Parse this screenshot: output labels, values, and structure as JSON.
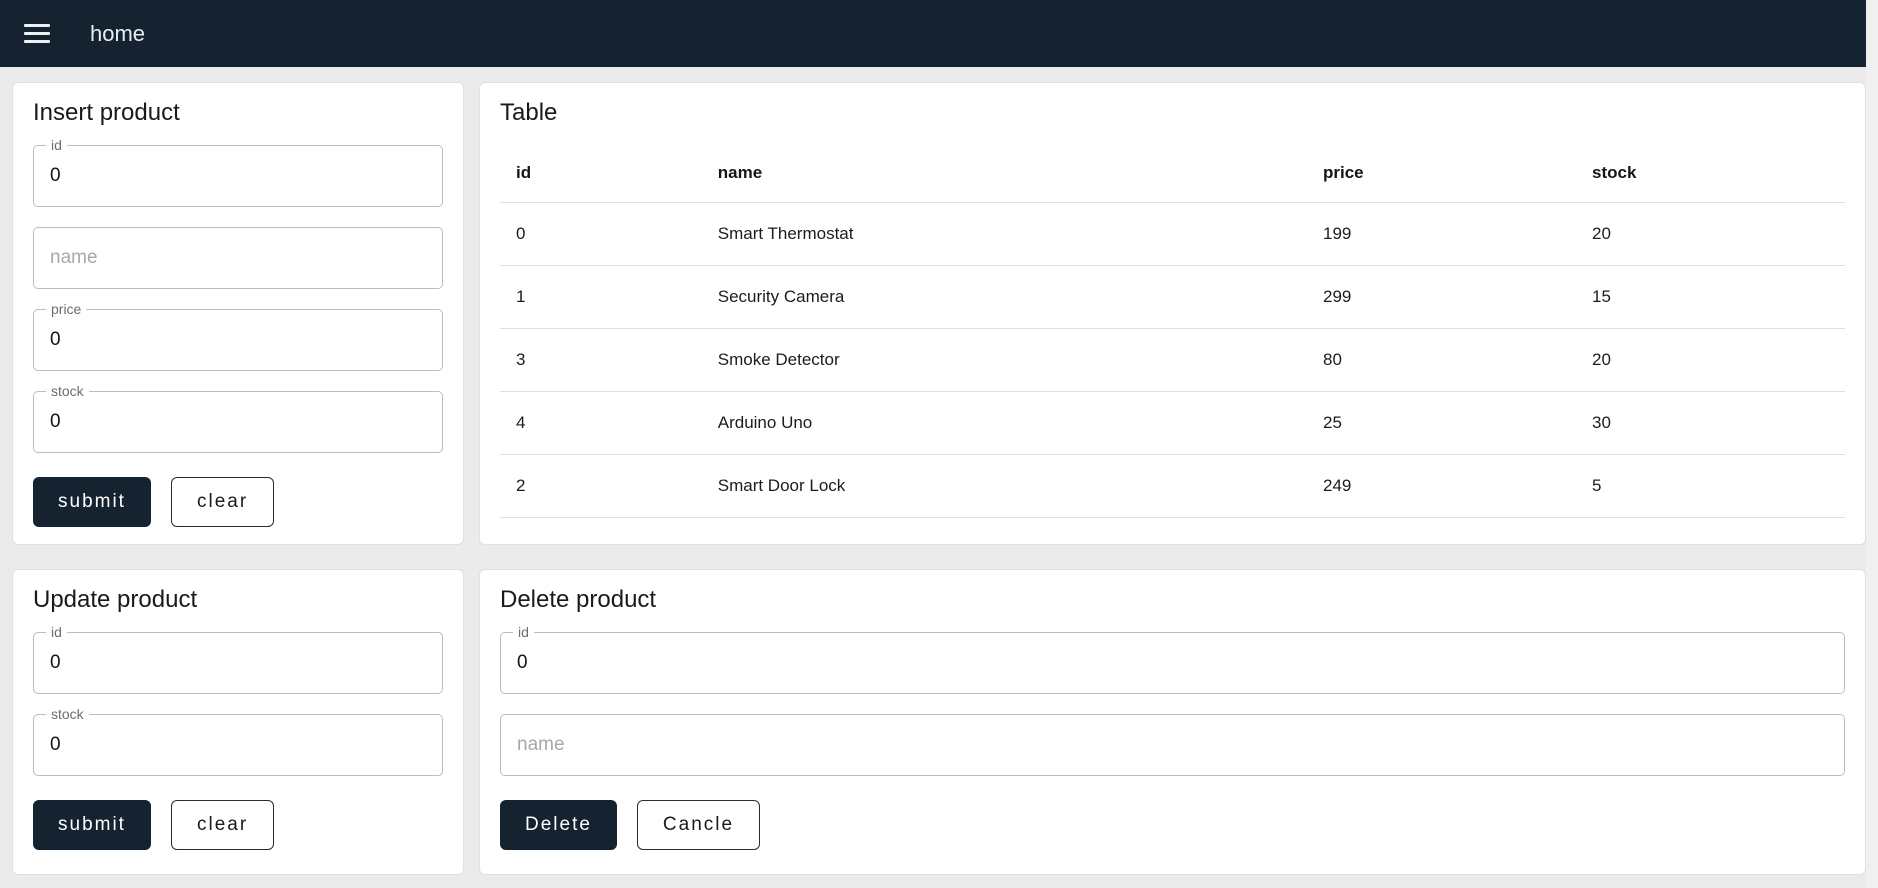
{
  "navbar": {
    "title": "home"
  },
  "colors": {
    "navbar_bg": "#15222f",
    "accent_dark": "#15222f",
    "page_bg": "#ebebeb",
    "panel_bg": "#ffffff",
    "divider": "#e0e0e0",
    "field_border": "#bdbdbd"
  },
  "insert": {
    "title": "Insert product",
    "id_label": "id",
    "id_value": "0",
    "name_placeholder": "name",
    "name_value": "",
    "price_label": "price",
    "price_value": "0",
    "stock_label": "stock",
    "stock_value": "0",
    "submit_label": "submit",
    "clear_label": "clear"
  },
  "table": {
    "title": "Table",
    "columns": [
      "id",
      "name",
      "price",
      "stock"
    ],
    "rows": [
      {
        "id": "0",
        "name": "Smart Thermostat",
        "price": "199",
        "stock": "20"
      },
      {
        "id": "1",
        "name": "Security Camera",
        "price": "299",
        "stock": "15"
      },
      {
        "id": "3",
        "name": "Smoke Detector",
        "price": "80",
        "stock": "20"
      },
      {
        "id": "4",
        "name": "Arduino Uno",
        "price": "25",
        "stock": "30"
      },
      {
        "id": "2",
        "name": "Smart Door Lock",
        "price": "249",
        "stock": "5"
      }
    ]
  },
  "update": {
    "title": "Update product",
    "id_label": "id",
    "id_value": "0",
    "stock_label": "stock",
    "stock_value": "0",
    "submit_label": "submit",
    "clear_label": "clear"
  },
  "delete": {
    "title": "Delete product",
    "id_label": "id",
    "id_value": "0",
    "name_placeholder": "name",
    "name_value": "",
    "delete_label": "Delete",
    "cancel_label": "Cancle"
  }
}
